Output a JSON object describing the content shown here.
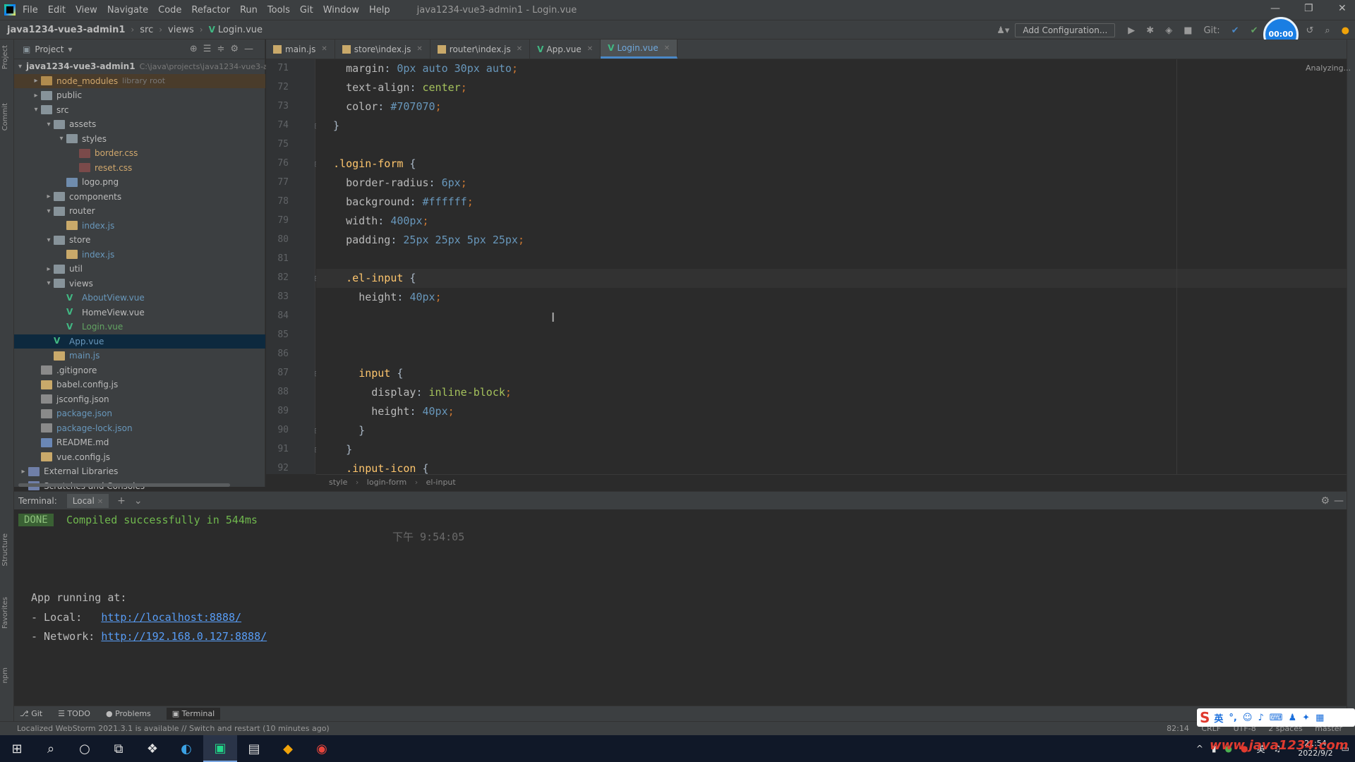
{
  "menubar": {
    "items": [
      "File",
      "Edit",
      "View",
      "Navigate",
      "Code",
      "Refactor",
      "Run",
      "Tools",
      "Git",
      "Window",
      "Help"
    ],
    "window_title": "java1234-vue3-admin1 - Login.vue"
  },
  "navbar": {
    "project": "java1234-vue3-admin1",
    "crumbs": [
      "src",
      "views",
      "Login.vue"
    ],
    "add_config": "Add Configuration...",
    "git_label": "Git:"
  },
  "avatar": {
    "text": "00:00"
  },
  "left_strip": {
    "tabs": [
      "Project",
      "Commit",
      "Structure",
      "Favorites",
      "npm"
    ]
  },
  "project_panel": {
    "title": "Project",
    "tree": [
      {
        "depth": 0,
        "arrow": "v",
        "icon": "folder",
        "label": "java1234-vue3-admin1",
        "hint": "C:\\java\\projects\\java1234-vue3-admin1",
        "style": "bold"
      },
      {
        "depth": 1,
        "arrow": ">",
        "icon": "folder-ex",
        "label": "node_modules",
        "hint": "library root",
        "style": "mod",
        "excluded": true
      },
      {
        "depth": 1,
        "arrow": ">",
        "icon": "folder",
        "label": "public",
        "style": ""
      },
      {
        "depth": 1,
        "arrow": "v",
        "icon": "folder",
        "label": "src",
        "style": ""
      },
      {
        "depth": 2,
        "arrow": "v",
        "icon": "folder",
        "label": "assets",
        "style": ""
      },
      {
        "depth": 3,
        "arrow": "v",
        "icon": "folder",
        "label": "styles",
        "style": ""
      },
      {
        "depth": 4,
        "arrow": "",
        "icon": "file-css",
        "label": "border.css",
        "style": "mod"
      },
      {
        "depth": 4,
        "arrow": "",
        "icon": "file-css",
        "label": "reset.css",
        "style": "mod"
      },
      {
        "depth": 3,
        "arrow": "",
        "icon": "file-png",
        "label": "logo.png",
        "style": ""
      },
      {
        "depth": 2,
        "arrow": ">",
        "icon": "folder",
        "label": "components",
        "style": ""
      },
      {
        "depth": 2,
        "arrow": "v",
        "icon": "folder",
        "label": "router",
        "style": ""
      },
      {
        "depth": 3,
        "arrow": "",
        "icon": "file-js",
        "label": "index.js",
        "style": "blue"
      },
      {
        "depth": 2,
        "arrow": "v",
        "icon": "folder",
        "label": "store",
        "style": ""
      },
      {
        "depth": 3,
        "arrow": "",
        "icon": "file-js",
        "label": "index.js",
        "style": "blue"
      },
      {
        "depth": 2,
        "arrow": ">",
        "icon": "folder",
        "label": "util",
        "style": ""
      },
      {
        "depth": 2,
        "arrow": "v",
        "icon": "folder",
        "label": "views",
        "style": ""
      },
      {
        "depth": 3,
        "arrow": "",
        "icon": "vue",
        "label": "AboutView.vue",
        "style": "blue"
      },
      {
        "depth": 3,
        "arrow": "",
        "icon": "vue",
        "label": "HomeView.vue",
        "style": ""
      },
      {
        "depth": 3,
        "arrow": "",
        "icon": "vue",
        "label": "Login.vue",
        "style": "green"
      },
      {
        "depth": 2,
        "arrow": "",
        "icon": "vue",
        "label": "App.vue",
        "style": "blue",
        "selected": true
      },
      {
        "depth": 2,
        "arrow": "",
        "icon": "file-js",
        "label": "main.js",
        "style": "blue"
      },
      {
        "depth": 1,
        "arrow": "",
        "icon": "file-json",
        "label": ".gitignore",
        "style": ""
      },
      {
        "depth": 1,
        "arrow": "",
        "icon": "file-js",
        "label": "babel.config.js",
        "style": ""
      },
      {
        "depth": 1,
        "arrow": "",
        "icon": "file-json",
        "label": "jsconfig.json",
        "style": ""
      },
      {
        "depth": 1,
        "arrow": "",
        "icon": "file-json",
        "label": "package.json",
        "style": "blue"
      },
      {
        "depth": 1,
        "arrow": "",
        "icon": "file-json",
        "label": "package-lock.json",
        "style": "blue"
      },
      {
        "depth": 1,
        "arrow": "",
        "icon": "file-md",
        "label": "README.md",
        "style": ""
      },
      {
        "depth": 1,
        "arrow": "",
        "icon": "file-js",
        "label": "vue.config.js",
        "style": ""
      },
      {
        "depth": 0,
        "arrow": ">",
        "icon": "lib",
        "label": "External Libraries",
        "style": ""
      },
      {
        "depth": 0,
        "arrow": "",
        "icon": "lib",
        "label": "Scratches and Consoles",
        "style": ""
      }
    ]
  },
  "editor_tabs": [
    {
      "label": "main.js",
      "type": "js",
      "active": false
    },
    {
      "label": "store\\index.js",
      "type": "js",
      "active": false
    },
    {
      "label": "router\\index.js",
      "type": "js",
      "active": false
    },
    {
      "label": "App.vue",
      "type": "vue",
      "active": false
    },
    {
      "label": "Login.vue",
      "type": "vue",
      "active": true
    }
  ],
  "editor": {
    "analyzing": "Analyzing...",
    "lines": [
      {
        "n": "71",
        "code": [
          [
            "    ",
            "txt"
          ],
          [
            "margin",
            "p"
          ],
          [
            ": ",
            "txt"
          ],
          [
            "0px auto 30px auto",
            "v"
          ],
          [
            ";",
            "punct"
          ]
        ]
      },
      {
        "n": "72",
        "code": [
          [
            "    ",
            "txt"
          ],
          [
            "text-align",
            "p"
          ],
          [
            ": ",
            "txt"
          ],
          [
            "center",
            "s"
          ],
          [
            ";",
            "punct"
          ]
        ]
      },
      {
        "n": "73",
        "code": [
          [
            "    ",
            "txt"
          ],
          [
            "color",
            "p"
          ],
          [
            ": ",
            "txt"
          ],
          [
            "#707070",
            "v"
          ],
          [
            ";",
            "punct"
          ]
        ]
      },
      {
        "n": "74",
        "code": [
          [
            "  }",
            "txt"
          ]
        ]
      },
      {
        "n": "75",
        "code": [
          [
            "",
            "txt"
          ]
        ]
      },
      {
        "n": "76",
        "code": [
          [
            "  ",
            "txt"
          ],
          [
            ".login-form",
            "k"
          ],
          [
            " {",
            "txt"
          ]
        ]
      },
      {
        "n": "77",
        "code": [
          [
            "    ",
            "txt"
          ],
          [
            "border-radius",
            "p"
          ],
          [
            ": ",
            "txt"
          ],
          [
            "6px",
            "v"
          ],
          [
            ";",
            "punct"
          ]
        ]
      },
      {
        "n": "78",
        "code": [
          [
            "    ",
            "txt"
          ],
          [
            "background",
            "p"
          ],
          [
            ": ",
            "txt"
          ],
          [
            "#ffffff",
            "v"
          ],
          [
            ";",
            "punct"
          ]
        ]
      },
      {
        "n": "79",
        "code": [
          [
            "    ",
            "txt"
          ],
          [
            "width",
            "p"
          ],
          [
            ": ",
            "txt"
          ],
          [
            "400px",
            "v"
          ],
          [
            ";",
            "punct"
          ]
        ]
      },
      {
        "n": "80",
        "code": [
          [
            "    ",
            "txt"
          ],
          [
            "padding",
            "p"
          ],
          [
            ": ",
            "txt"
          ],
          [
            "25px 25px 5px 25px",
            "v"
          ],
          [
            ";",
            "punct"
          ]
        ]
      },
      {
        "n": "81",
        "code": [
          [
            "",
            "txt"
          ]
        ]
      },
      {
        "n": "82",
        "code": [
          [
            "    ",
            "txt"
          ],
          [
            ".el-input",
            "k"
          ],
          [
            " {",
            "txt"
          ]
        ],
        "current": true
      },
      {
        "n": "83",
        "code": [
          [
            "      ",
            "txt"
          ],
          [
            "height",
            "p"
          ],
          [
            ": ",
            "txt"
          ],
          [
            "40px",
            "v"
          ],
          [
            ";",
            "punct"
          ]
        ]
      },
      {
        "n": "84",
        "code": [
          [
            "",
            "txt"
          ]
        ]
      },
      {
        "n": "85",
        "code": [
          [
            "",
            "txt"
          ]
        ]
      },
      {
        "n": "86",
        "code": [
          [
            "",
            "txt"
          ]
        ]
      },
      {
        "n": "87",
        "code": [
          [
            "      ",
            "txt"
          ],
          [
            "input",
            "k"
          ],
          [
            " {",
            "txt"
          ]
        ]
      },
      {
        "n": "88",
        "code": [
          [
            "        ",
            "txt"
          ],
          [
            "display",
            "p"
          ],
          [
            ": ",
            "txt"
          ],
          [
            "inline-block",
            "s"
          ],
          [
            ";",
            "punct"
          ]
        ]
      },
      {
        "n": "89",
        "code": [
          [
            "        ",
            "txt"
          ],
          [
            "height",
            "p"
          ],
          [
            ": ",
            "txt"
          ],
          [
            "40px",
            "v"
          ],
          [
            ";",
            "punct"
          ]
        ]
      },
      {
        "n": "90",
        "code": [
          [
            "      }",
            "txt"
          ]
        ]
      },
      {
        "n": "91",
        "code": [
          [
            "    }",
            "txt"
          ]
        ]
      },
      {
        "n": "92",
        "code": [
          [
            "    ",
            "txt"
          ],
          [
            ".input-icon",
            "k"
          ],
          [
            " {",
            "txt"
          ]
        ]
      }
    ],
    "breadcrumb": [
      "style",
      "login-form",
      "el-input"
    ]
  },
  "terminal": {
    "title": "Terminal:",
    "tab": "Local",
    "done": "DONE",
    "compiled": "Compiled successfully in 544ms",
    "time": "下午 9:54:05",
    "app_running": "App running at:",
    "local_label": "- Local:   ",
    "local_url": "http://localhost:8888/",
    "network_label": "- Network: ",
    "network_url": "http://192.168.0.127:8888/"
  },
  "bottom_tools": [
    "Git",
    "TODO",
    "Problems",
    "Terminal"
  ],
  "statusbar": {
    "message": "Localized WebStorm 2021.3.1 is available // Switch and restart (10 minutes ago)",
    "right": [
      "82:14",
      "CRLF",
      "UTF-8",
      "2 spaces",
      "master"
    ]
  },
  "taskbar": {
    "clock_time": "21:54",
    "clock_date": "2022/9/2",
    "tray_lang": "英",
    "watermark": "www.java1234.com"
  }
}
